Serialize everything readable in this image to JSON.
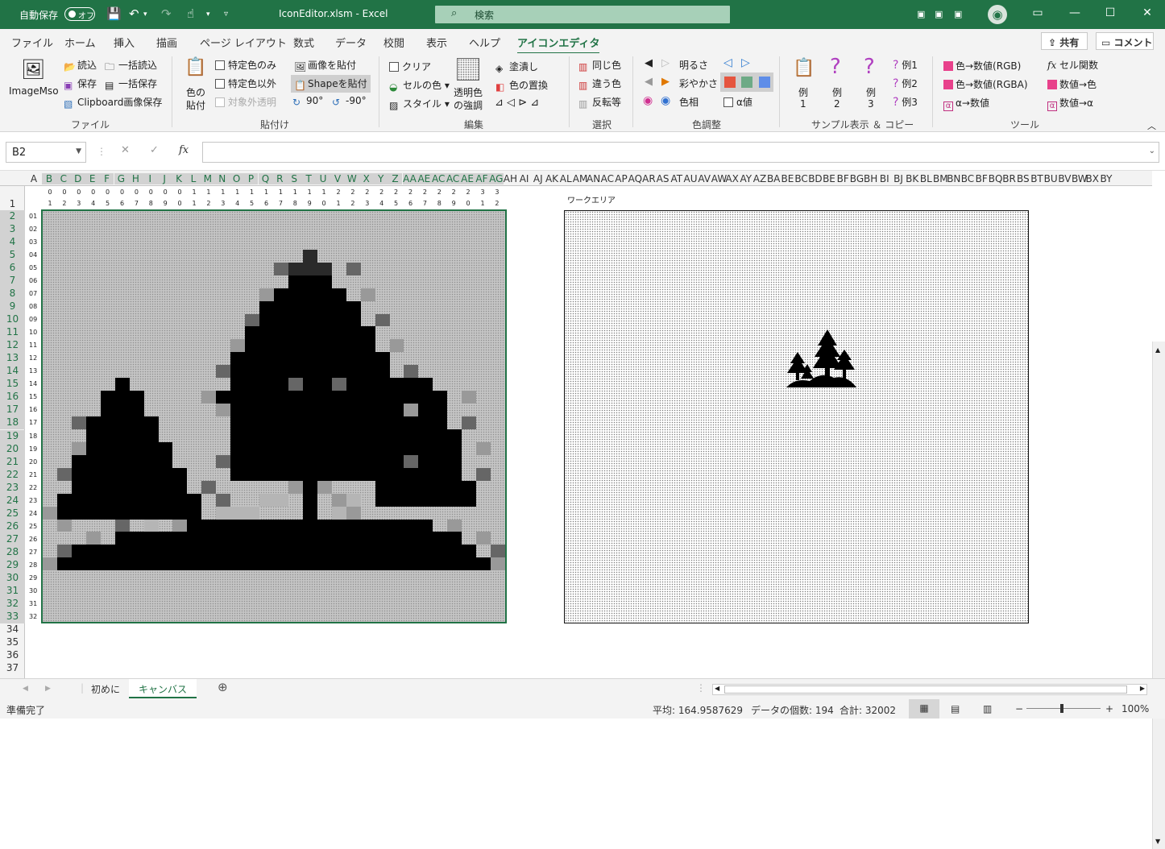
{
  "titlebar": {
    "autosave_label": "自動保存",
    "autosave_state": "オフ",
    "document": "IconEditor.xlsm  -  Excel",
    "search_placeholder": "検索",
    "search_icon": "search-icon"
  },
  "tabs": [
    "ファイル",
    "ホーム",
    "挿入",
    "描画",
    "ページ レイアウト",
    "数式",
    "データ",
    "校閲",
    "表示",
    "ヘルプ",
    "アイコンエディタ"
  ],
  "active_tab": "アイコンエディタ",
  "share_label": "共有",
  "comment_label": "コメント",
  "ribbon": {
    "file_group": {
      "label": "ファイル",
      "imagemso": "ImageMso",
      "read": "読込",
      "save": "保存",
      "batch_read": "一括読込",
      "batch_save": "一括保存",
      "clipboard_save": "Clipboard画像保存"
    },
    "paste_group": {
      "label": "貼付け",
      "color_paste_1": "色の",
      "color_paste_2": "貼付",
      "specific_only": "特定色のみ",
      "except_specific": "特定色以外",
      "transparent_target": "対象外透明",
      "paste_image": "画像を貼付",
      "paste_shape": "Shapeを貼付",
      "rot_p90": "90°",
      "rot_m90": "-90°"
    },
    "edit_group": {
      "label": "編集",
      "clear": "クリア",
      "cell_color": "セルの色",
      "style": "スタイル",
      "transparent_1": "透明色",
      "transparent_2": "の強調",
      "fill": "塗潰し",
      "replace": "色の置換"
    },
    "select_group": {
      "label": "選択",
      "same_color": "同じ色",
      "diff_color": "違う色",
      "invert": "反転等"
    },
    "color_group": {
      "label": "色調整",
      "brightness": "明るさ",
      "saturation": "彩やかさ",
      "hue": "色相",
      "alpha": "α値"
    },
    "sample_group": {
      "label": "サンプル表示 ＆ コピー",
      "ex1_a": "例",
      "ex1_b": "1",
      "ex2_a": "例",
      "ex2_b": "2",
      "ex3_a": "例",
      "ex3_b": "3",
      "s_ex1": "例1",
      "s_ex2": "例2",
      "s_ex3": "例3"
    },
    "tools_group": {
      "label": "ツール",
      "rgb": "色→数値(RGB)",
      "rgba": "色→数値(RGBA)",
      "alpha_num": "α→数値",
      "cell_func": "セル関数",
      "num_color": "数値→色",
      "num_alpha": "数値→α"
    }
  },
  "formula": {
    "namebox": "B2",
    "fx": "fx",
    "value": ""
  },
  "columns": [
    "A",
    "B",
    "C",
    "D",
    "E",
    "F",
    "G",
    "H",
    "I",
    "J",
    "K",
    "L",
    "M",
    "N",
    "O",
    "P",
    "Q",
    "R",
    "S",
    "T",
    "U",
    "V",
    "W",
    "X",
    "Y",
    "Z",
    "AA",
    "AE",
    "AC",
    "AC",
    "AE",
    "AF",
    "AG",
    "AH",
    "AI",
    "AJ",
    "AK",
    "AL",
    "AM",
    "AN",
    "AC",
    "AP",
    "AQ",
    "AR",
    "AS",
    "AT",
    "AU",
    "AV",
    "AW",
    "AX",
    "AY",
    "AZ",
    "BA",
    "BE",
    "BC",
    "BD",
    "BE",
    "BF",
    "BG",
    "BH",
    "BI",
    "BJ",
    "BK",
    "BL",
    "BM",
    "BN",
    "BC",
    "BF",
    "BQ",
    "BR",
    "BS",
    "BT",
    "BU",
    "BV",
    "BW",
    "BX",
    "BY"
  ],
  "rows": [
    "1",
    "2",
    "3",
    "4",
    "5",
    "6",
    "7",
    "8",
    "9",
    "10",
    "11",
    "12",
    "13",
    "14",
    "15",
    "16",
    "17",
    "18",
    "19",
    "20",
    "21",
    "22",
    "23",
    "24",
    "25",
    "26",
    "27",
    "28",
    "29",
    "30",
    "31",
    "32",
    "33",
    "34",
    "35",
    "36",
    "37"
  ],
  "col_numbers_top": [
    "0",
    "0",
    "0",
    "0",
    "0",
    "0",
    "0",
    "0",
    "0",
    "0",
    "1",
    "1",
    "1",
    "1",
    "1",
    "1",
    "1",
    "1",
    "1",
    "1",
    "2",
    "2",
    "2",
    "2",
    "2",
    "2",
    "2",
    "2",
    "2",
    "2",
    "3",
    "3",
    "3"
  ],
  "col_numbers_bottom": [
    "1",
    "2",
    "3",
    "4",
    "5",
    "6",
    "7",
    "8",
    "9",
    "0",
    "1",
    "2",
    "3",
    "4",
    "5",
    "6",
    "7",
    "8",
    "9",
    "0",
    "1",
    "2",
    "3",
    "4",
    "5",
    "6",
    "7",
    "8",
    "9",
    "0",
    "1",
    "2"
  ],
  "row_numbers": [
    "01",
    "02",
    "03",
    "04",
    "05",
    "06",
    "07",
    "08",
    "09",
    "10",
    "11",
    "12",
    "13",
    "14",
    "15",
    "16",
    "17",
    "18",
    "19",
    "20",
    "21",
    "22",
    "23",
    "24",
    "25",
    "26",
    "27",
    "28",
    "29",
    "30",
    "31",
    "32"
  ],
  "work_area_label": "ワークエリア",
  "sheets": [
    "初めに",
    "キャンバス"
  ],
  "active_sheet": "キャンバス",
  "status": {
    "ready": "準備完了",
    "average": "平均: 164.9587629",
    "count": "データの個数: 194",
    "sum": "合計: 32002",
    "zoom": "100%"
  },
  "colors": {
    "excel_green": "#217346",
    "canvas_bg": "#c4c4c4",
    "ink": "#000000"
  }
}
